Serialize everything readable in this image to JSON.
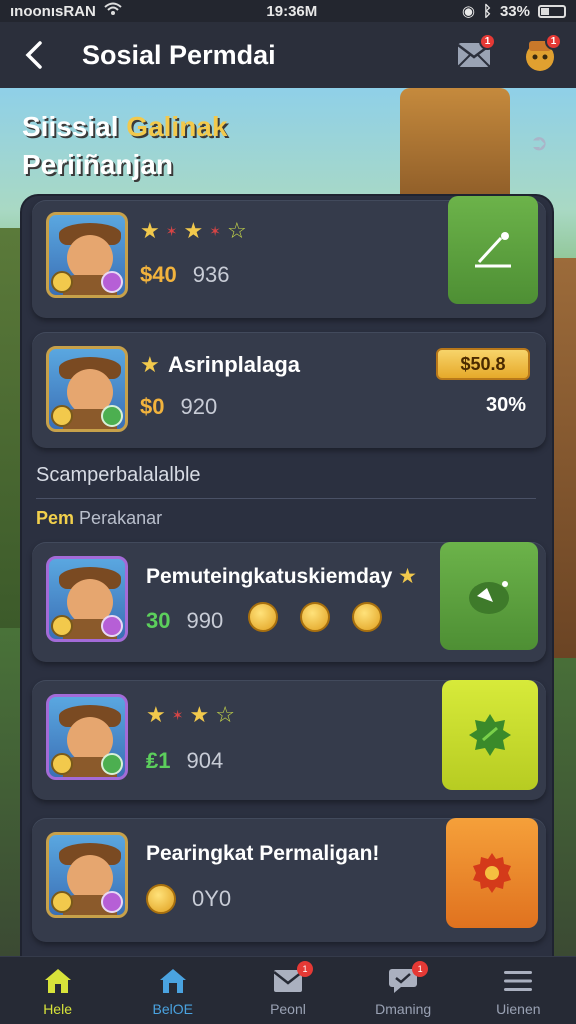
{
  "status_bar": {
    "carrier": "ınoonısRAN",
    "time": "19:36M",
    "battery": "33%"
  },
  "header": {
    "back_icon": "chevron-left-icon",
    "title": "Sosial Permdai",
    "mail_badge": "1",
    "profile_badge": "1"
  },
  "page_heading": {
    "line1_prefix": "Siissial",
    "line1_accent": "Galinak",
    "line2": "Periiñanjan"
  },
  "cards": [
    {
      "stars": [
        "★",
        "✶",
        "★",
        "✶",
        "☆"
      ],
      "amount": "$40",
      "number": "936",
      "action_icon": "check-edit-icon"
    },
    {
      "title": "Asrinplalaga",
      "amount": "$0",
      "number": "920",
      "price": "$50.8",
      "percent": "30%"
    },
    {
      "title": "Pemuteingkatuskiemdaу",
      "amount": "30",
      "number": "990",
      "action_icon": "thumb-icon"
    },
    {
      "stars": [
        "★",
        "✶",
        "★",
        "☆"
      ],
      "amount": "₤1",
      "number": "904",
      "action_icon": "leaf-icon"
    },
    {
      "title": "Pearingkat Permaligan!",
      "number": "0Y0",
      "action_icon": "gear-icon"
    }
  ],
  "section": {
    "label": "Scamperbalalalble",
    "sub_yellow": "Pem",
    "sub_grey": "Perakanar"
  },
  "bottom_nav": [
    {
      "label": "Hele",
      "icon": "home-icon"
    },
    {
      "label": "BelOE",
      "icon": "house-blue-icon"
    },
    {
      "label": "Peonl",
      "icon": "mail-icon",
      "badge": "1"
    },
    {
      "label": "Dmaning",
      "icon": "chat-icon",
      "badge": "1"
    },
    {
      "label": "Uienen",
      "icon": "menu-icon"
    }
  ]
}
